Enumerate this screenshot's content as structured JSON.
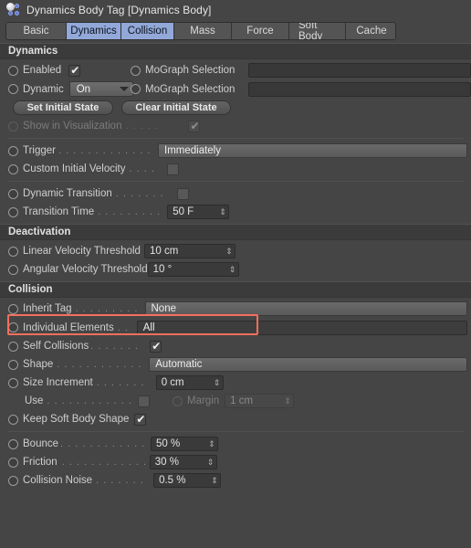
{
  "window": {
    "title": "Dynamics Body Tag [Dynamics Body]",
    "icon": "dynamics-body-tag-icon"
  },
  "tabs": [
    {
      "label": "Basic",
      "active": false
    },
    {
      "label": "Dynamics",
      "active": true
    },
    {
      "label": "Collision",
      "active": true
    },
    {
      "label": "Mass",
      "active": false
    },
    {
      "label": "Force",
      "active": false
    },
    {
      "label": "Soft Body",
      "active": false
    },
    {
      "label": "Cache",
      "active": false
    }
  ],
  "sections": {
    "dynamics": {
      "header": "Dynamics",
      "enabled": {
        "label": "Enabled",
        "checked": "✔"
      },
      "mograph_selection_1": {
        "label": "MoGraph Selection",
        "value": ""
      },
      "dynamic": {
        "label": "Dynamic",
        "value": "On"
      },
      "mograph_selection_2": {
        "label": "MoGraph Selection",
        "value": ""
      },
      "set_initial_state": "Set Initial State",
      "clear_initial_state": "Clear Initial State",
      "show_in_visualization": {
        "label": "Show in Visualization",
        "dots": ". . . . .",
        "checked": "✔"
      },
      "trigger": {
        "label": "Trigger",
        "dots": ". . . . . . . . . . . . . . .",
        "value": "Immediately"
      },
      "custom_initial_velocity": {
        "label": "Custom Initial Velocity",
        "dots": ". . . .",
        "checked": ""
      },
      "dynamic_transition": {
        "label": "Dynamic Transition",
        "dots": ". . . . . . .",
        "checked": ""
      },
      "transition_time": {
        "label": "Transition Time",
        "dots": ". . . . . . . . . .",
        "value": "50 F"
      }
    },
    "deactivation": {
      "header": "Deactivation",
      "linear_velocity_threshold": {
        "label": "Linear Velocity Threshold",
        "value": "10 cm"
      },
      "angular_velocity_threshold": {
        "label": "Angular Velocity Threshold",
        "value": "10 °"
      }
    },
    "collision": {
      "header": "Collision",
      "inherit_tag": {
        "label": "Inherit Tag",
        "dots": ". . . . . . . . . .",
        "value": "None"
      },
      "individual_elements": {
        "label": "Individual Elements",
        "dots": ". .",
        "value": "All",
        "highlighted": true
      },
      "self_collisions": {
        "label": "Self Collisions",
        "dots": ". . . . . . .",
        "checked": "✔"
      },
      "shape": {
        "label": "Shape",
        "dots": ". . . . . . . . . . . . .",
        "value": "Automatic"
      },
      "size_increment": {
        "label": "Size Increment",
        "dots": ". . . . . . .",
        "value": "0 cm"
      },
      "use": {
        "label": "Use",
        "dots": ". . . . . . . . . . . . . . .",
        "checked": ""
      },
      "margin": {
        "label": "Margin",
        "value": "1 cm"
      },
      "keep_soft_body_shape": {
        "label": "Keep Soft Body Shape",
        "checked": "✔"
      },
      "bounce": {
        "label": "Bounce",
        "dots": ". . . . . . . . . . . . .",
        "value": "50 %"
      },
      "friction": {
        "label": "Friction",
        "dots": ". . . . . . . . . . . . .",
        "value": "30 %"
      },
      "collision_noise": {
        "label": "Collision Noise",
        "dots": ". . . . . . .",
        "value": "0.5 %"
      }
    }
  },
  "colors": {
    "background": "#454545",
    "section_header": "#3b3b3b",
    "tab_active": "#92a8d8",
    "highlight_annotation": "#f4705c",
    "text": "#cfcfcf"
  },
  "spinner_glyph": "⇕"
}
